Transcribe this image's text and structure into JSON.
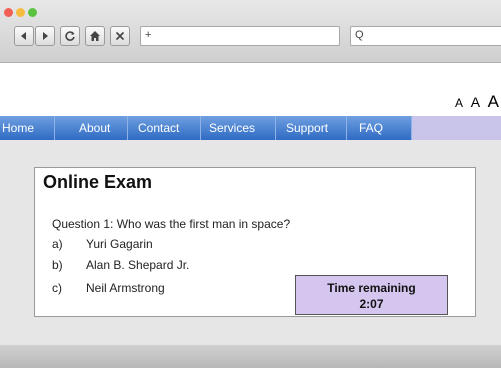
{
  "browser": {
    "url": "+",
    "search_icon_label": "Q",
    "colors": {
      "close": "#f25f55",
      "minimize": "#f6bc3f",
      "zoom": "#5bc33f"
    }
  },
  "text_size": [
    "A",
    "A",
    "A"
  ],
  "nav": {
    "items": [
      "Home",
      "About",
      "Contact",
      "Services",
      "Support",
      "FAQ"
    ]
  },
  "exam": {
    "title": "Online Exam",
    "question": "Question 1: Who  was the first man in space?",
    "options": [
      {
        "letter": "a)",
        "text": "Yuri Gagarin"
      },
      {
        "letter": "b)",
        "text": "Alan B. Shepard Jr."
      },
      {
        "letter": "c)",
        "text": "Neil Armstrong"
      }
    ],
    "timer": {
      "label": "Time remaining",
      "value": "2:07"
    }
  }
}
